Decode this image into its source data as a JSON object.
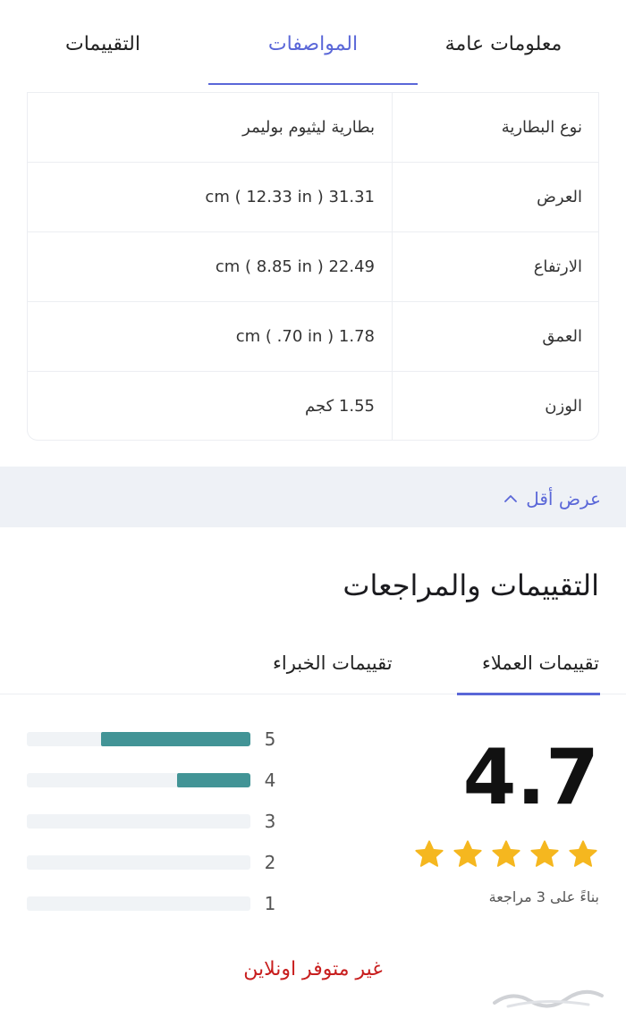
{
  "tabs": [
    {
      "id": "general",
      "label": "معلومات عامة",
      "active": false
    },
    {
      "id": "specs",
      "label": "المواصفات",
      "active": true
    },
    {
      "id": "ratings",
      "label": "التقييمات",
      "active": false
    }
  ],
  "specs": [
    {
      "label": "نوع البطارية",
      "value": "بطارية ليثيوم بوليمر"
    },
    {
      "label": "العرض",
      "value": "31.31 cm ( 12.33 in )"
    },
    {
      "label": "الارتفاع",
      "value": "22.49 cm ( 8.85 in )"
    },
    {
      "label": "العمق",
      "value": "1.78 cm ( .70 in )"
    },
    {
      "label": "الوزن",
      "value": "1.55 كجم"
    }
  ],
  "show_less_label": "عرض أقل",
  "reviews": {
    "title": "التقييمات والمراجعات",
    "tabs": [
      {
        "label": "تقييمات العملاء",
        "active": true
      },
      {
        "label": "تقييمات الخبراء",
        "active": false
      }
    ],
    "score": "4.7",
    "stars": 5,
    "based_on": "بناءً على 3 مراجعة",
    "distribution": [
      {
        "stars": "5",
        "fraction": 0.67
      },
      {
        "stars": "4",
        "fraction": 0.33
      },
      {
        "stars": "3",
        "fraction": 0
      },
      {
        "stars": "2",
        "fraction": 0
      },
      {
        "stars": "1",
        "fraction": 0
      }
    ]
  },
  "availability": "غير متوفر اونلاين",
  "colors": {
    "accent": "#5a67d8",
    "bar": "#429496",
    "star": "#f5b71f",
    "unavailable": "#c81e1e"
  }
}
